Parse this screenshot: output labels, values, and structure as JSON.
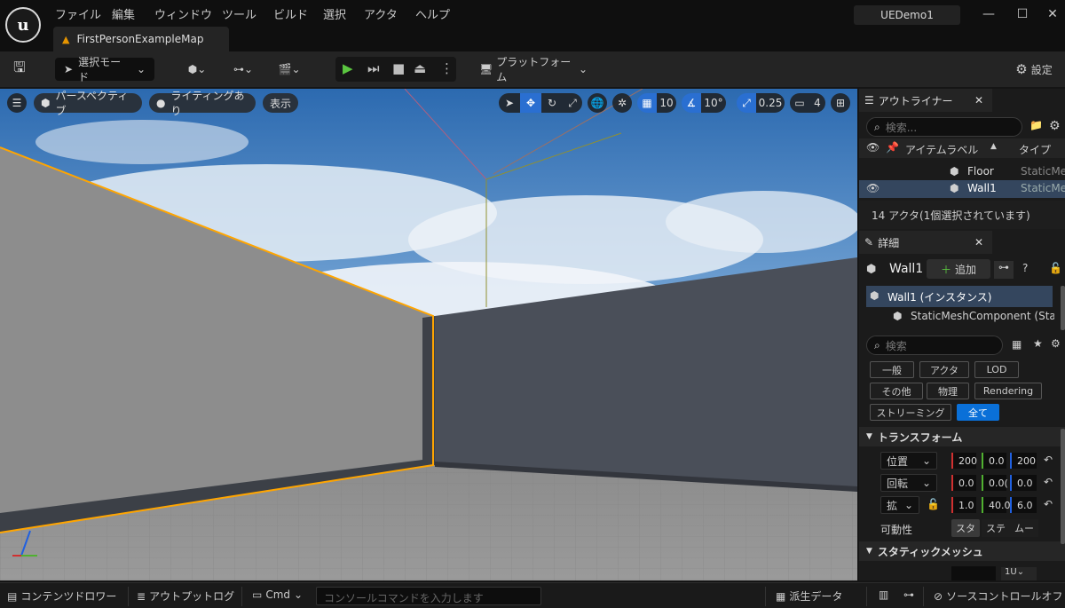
{
  "menu": [
    "ファイル",
    "編集",
    "ウィンドウ",
    "ツール",
    "ビルド",
    "選択",
    "アクタ",
    "ヘルプ"
  ],
  "project_name": "UEDemo1",
  "map_tab": "FirstPersonExampleMap",
  "toolbar": {
    "select_mode": "選択モード",
    "platform": "プラットフォーム",
    "settings": "設定"
  },
  "viewport": {
    "perspective": "パースペクティブ",
    "lighting": "ライティングあり",
    "show": "表示",
    "grid_snap": "10",
    "rotation_snap": "10°",
    "scale_snap": "0.25",
    "camera_speed": "4"
  },
  "outliner": {
    "title": "アウトライナー",
    "search_placeholder": "検索...",
    "col_label": "アイテムラベル",
    "col_type": "タイプ",
    "rows": [
      {
        "label": "Floor",
        "type": "StaticMe"
      },
      {
        "label": "Wall1",
        "type": "StaticMe"
      }
    ],
    "status": "14 アクタ(1個選択されています)"
  },
  "details": {
    "title": "詳細",
    "actor_name": "Wall1",
    "add_label": "追加",
    "instance": "Wall1 (インスタンス)",
    "component": "StaticMeshComponent (Static",
    "search_placeholder": "検索",
    "filters": [
      "一般",
      "アクタ",
      "LOD",
      "その他",
      "物理",
      "Rendering",
      "ストリーミング",
      "全て"
    ],
    "transform_title": "トランスフォーム",
    "location_label": "位置",
    "rotation_label": "回転",
    "scale_label": "拡",
    "location": [
      "200",
      "0.0",
      "200"
    ],
    "rotation": [
      "0.0",
      "0.0(",
      "0.0"
    ],
    "scale": [
      "1.0",
      "40.0",
      "6.0"
    ],
    "mobility_label": "可動性",
    "mobility": [
      "スタ",
      "ステ",
      "ムー"
    ],
    "static_mesh_title": "スタティックメッシュ",
    "mesh_value": "1U"
  },
  "statusbar": {
    "content_drawer": "コンテンツドロワー",
    "output_log": "アウトプットログ",
    "cmd": "Cmd",
    "console_placeholder": "コンソールコマンドを入力します",
    "derived_data": "派生データ",
    "source_control": "ソースコントロールオフ"
  },
  "colors": {
    "accent": "#0a70d8",
    "selection": "#ffa500",
    "bg": "#151515",
    "x_axis": "#d03030",
    "y_axis": "#50b030",
    "z_axis": "#2060e0"
  }
}
